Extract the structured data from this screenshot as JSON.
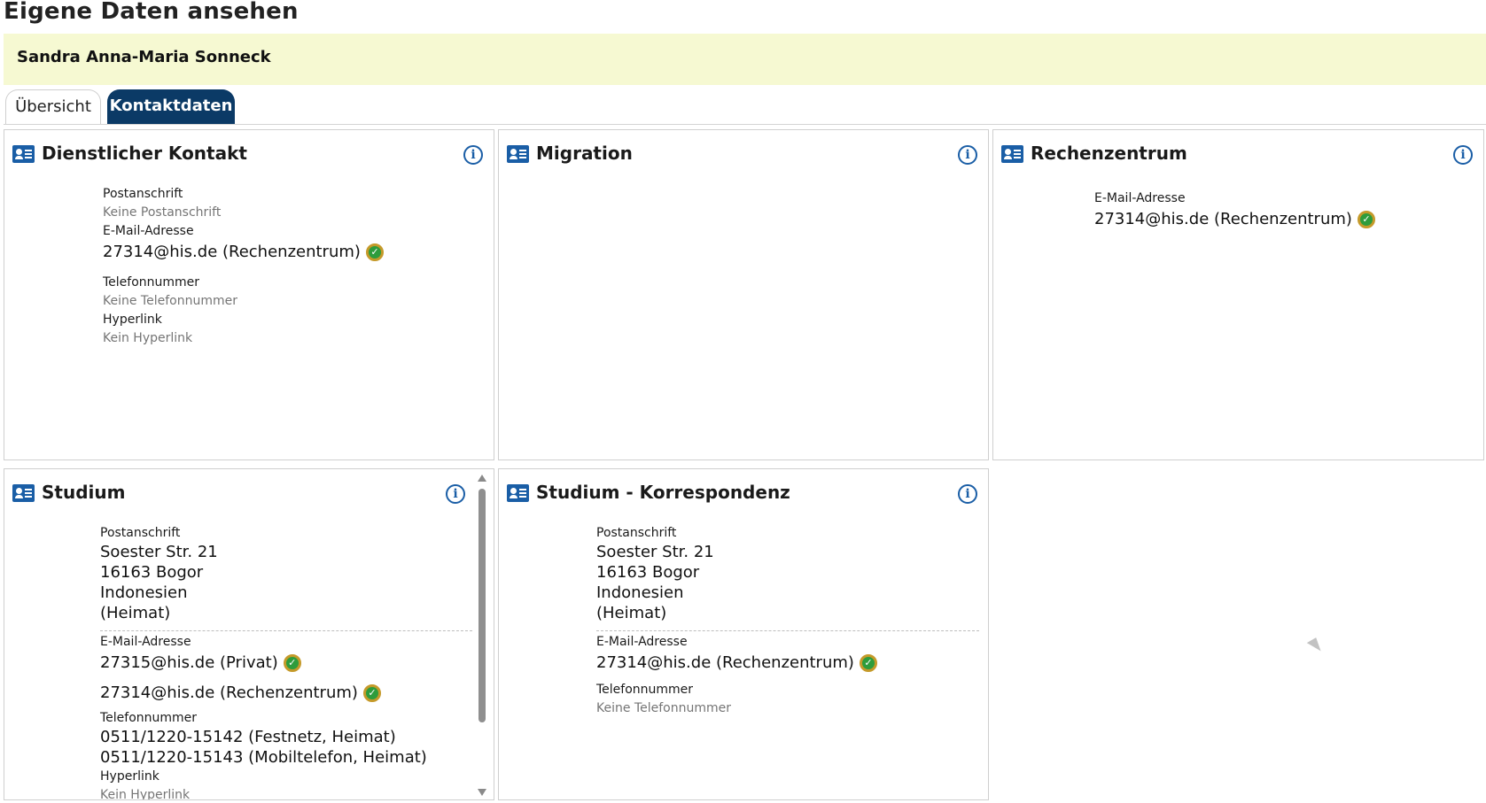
{
  "page": {
    "title": "Eigene Daten ansehen",
    "person_name": "Sandra Anna-Maria Sonneck"
  },
  "tabs": [
    {
      "label": "Übersicht",
      "active": false
    },
    {
      "label": "Kontaktdaten",
      "active": true
    }
  ],
  "colors": {
    "accent": "#0b3a66",
    "icon_blue": "#1a5ea6",
    "name_bar_bg": "#f6f9d2",
    "verified_green": "#2e9c3c"
  },
  "icons": {
    "card": "contact-card-icon",
    "info": "info-icon",
    "verified": "verified-check-icon"
  },
  "cards": {
    "dienstlich": {
      "title": "Dienstlicher Kontakt",
      "address_label": "Postanschrift",
      "address_value": "Keine Postanschrift",
      "email_label": "E-Mail-Adresse",
      "email_1": "27314@his.de (Rechenzentrum)",
      "phone_label": "Telefonnummer",
      "phone_value": "Keine Telefonnummer",
      "link_label": "Hyperlink",
      "link_value": "Kein Hyperlink"
    },
    "migration": {
      "title": "Migration"
    },
    "rechenzentrum": {
      "title": "Rechenzentrum",
      "email_label": "E-Mail-Adresse",
      "email_1": "27314@his.de (Rechenzentrum)"
    },
    "studium": {
      "title": "Studium",
      "address_label": "Postanschrift",
      "address_lines": [
        "Soester Str. 21",
        "16163 Bogor",
        "Indonesien",
        "(Heimat)"
      ],
      "email_label": "E-Mail-Adresse",
      "email_1": "27315@his.de (Privat)",
      "email_2": "27314@his.de (Rechenzentrum)",
      "phone_label": "Telefonnummer",
      "phone_1": "0511/1220-15142 (Festnetz, Heimat)",
      "phone_2": "0511/1220-15143 (Mobiltelefon, Heimat)",
      "link_label": "Hyperlink",
      "link_value": "Kein Hyperlink"
    },
    "korrespondenz": {
      "title": "Studium - Korrespondenz",
      "address_label": "Postanschrift",
      "address_lines": [
        "Soester Str. 21",
        "16163 Bogor",
        "Indonesien",
        "(Heimat)"
      ],
      "email_label": "E-Mail-Adresse",
      "email_1": "27314@his.de (Rechenzentrum)",
      "phone_label": "Telefonnummer",
      "phone_value": "Keine Telefonnummer"
    }
  }
}
